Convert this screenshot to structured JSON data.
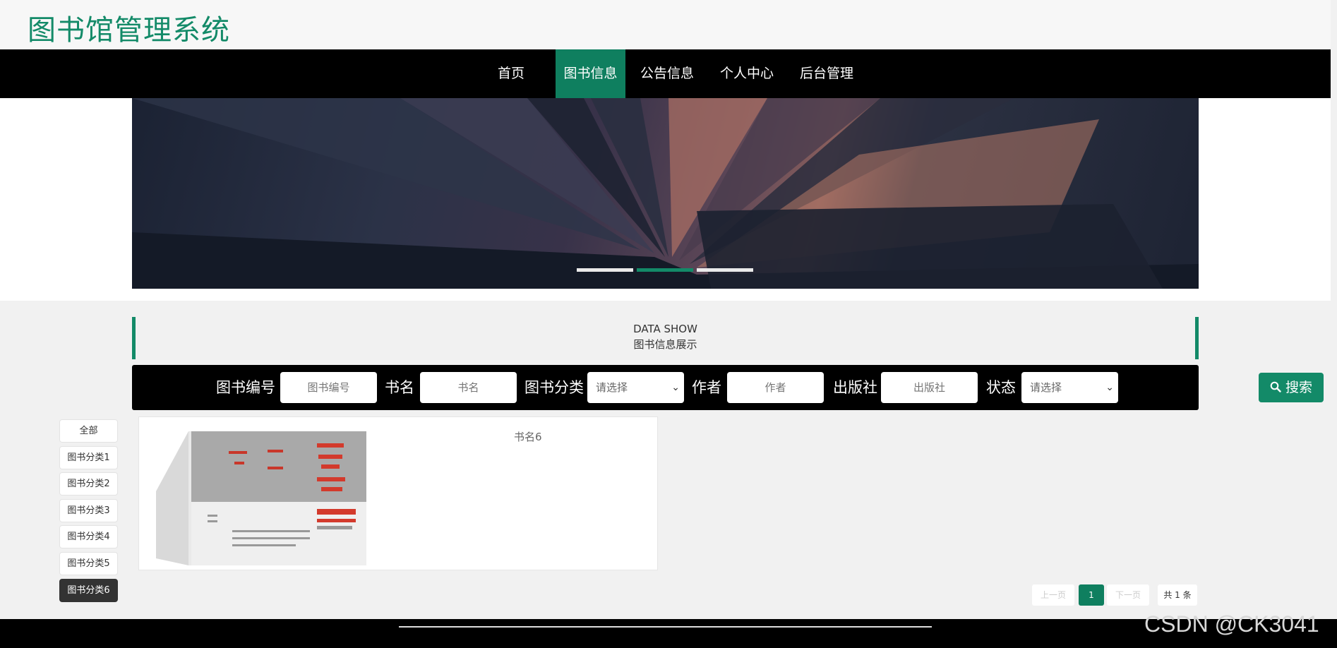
{
  "header": {
    "title": "图书馆管理系统"
  },
  "nav": {
    "items": [
      {
        "label": "首页"
      },
      {
        "label": "图书信息"
      },
      {
        "label": "公告信息"
      },
      {
        "label": "个人中心"
      },
      {
        "label": "后台管理"
      }
    ],
    "active_index": 1
  },
  "carousel": {
    "slide_count": 3,
    "active_index": 1
  },
  "section": {
    "title_en": "DATA SHOW",
    "title_cn": "图书信息展示"
  },
  "search": {
    "book_no_label": "图书编号",
    "book_no_placeholder": "图书编号",
    "name_label": "书名",
    "name_placeholder": "书名",
    "category_label": "图书分类",
    "category_value": "请选择",
    "author_label": "作者",
    "author_placeholder": "作者",
    "publisher_label": "出版社",
    "publisher_placeholder": "出版社",
    "status_label": "状态",
    "status_value": "请选择",
    "button_label": "搜索"
  },
  "categories": [
    "全部",
    "图书分类1",
    "图书分类2",
    "图书分类3",
    "图书分类4",
    "图书分类5",
    "图书分类6"
  ],
  "active_category_index": 6,
  "books": [
    {
      "name": "书名6"
    }
  ],
  "pagination": {
    "prev": "上一页",
    "current": "1",
    "next": "下一页",
    "total": "共 1 条"
  },
  "watermark": "CSDN @CK3041",
  "colors": {
    "accent": "#138a68",
    "nav_bg": "#000000",
    "page_bg": "#f1f1f1"
  }
}
